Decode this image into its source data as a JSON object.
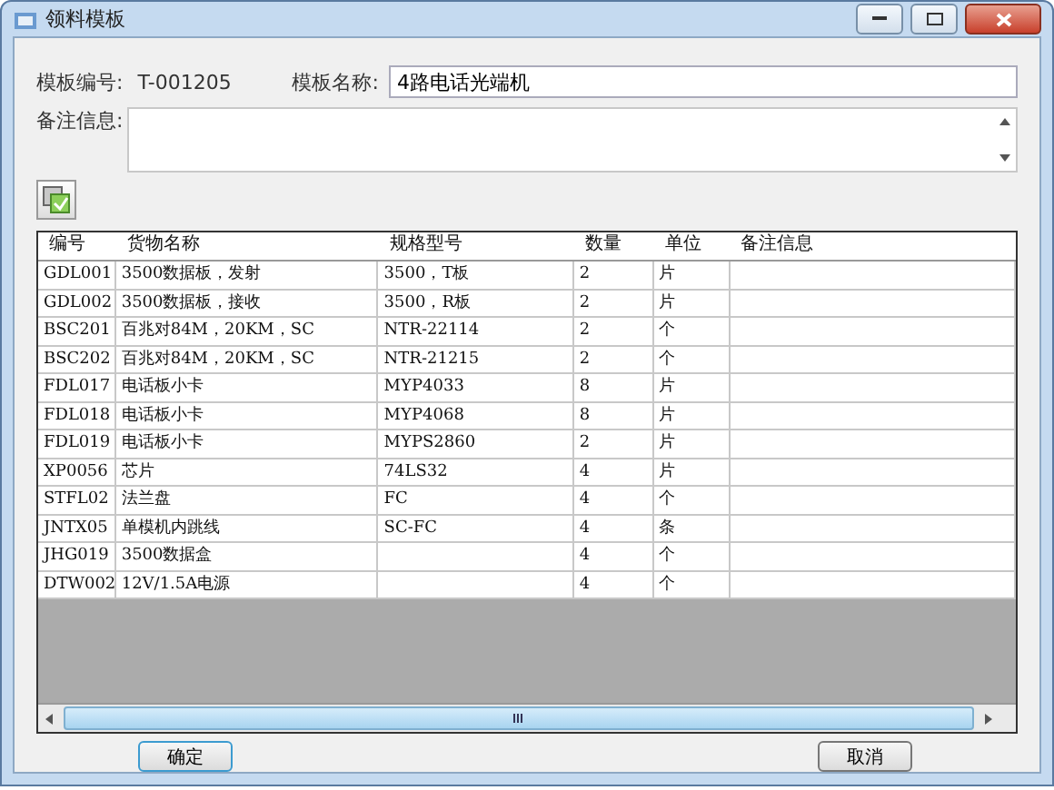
{
  "window": {
    "title": "领料模板"
  },
  "template_no": {
    "label": "模板编号:",
    "value": "T-001205"
  },
  "template_name": {
    "label": "模板名称:",
    "value": "4路电话光端机"
  },
  "remark": {
    "label": "备注信息:"
  },
  "table": {
    "columns": [
      "编号",
      "货物名称",
      "规格型号",
      "数量",
      "单位",
      "备注信息"
    ],
    "rows": [
      [
        "GDL001",
        "3500数据板，发射",
        "3500，T板",
        "2",
        "片"
      ],
      [
        "GDL002",
        "3500数据板，接收",
        "3500，R板",
        "2",
        "片"
      ],
      [
        "BSC201",
        "百兆对84M，20KM，SC",
        "NTR-22114",
        "2",
        "个"
      ],
      [
        "BSC202",
        "百兆对84M，20KM，SC",
        "NTR-21215",
        "2",
        "个"
      ],
      [
        "FDL017",
        "电话板小卡",
        "MYP4033",
        "8",
        "片"
      ],
      [
        "FDL018",
        "电话板小卡",
        "MYP4068",
        "8",
        "片"
      ],
      [
        "FDL019",
        "电话板小卡",
        "MYPS2860",
        "2",
        "片"
      ],
      [
        "XP0056",
        "芯片",
        "74LS32",
        "4",
        "片"
      ],
      [
        "STFL02",
        "法兰盘",
        "FC",
        "4",
        "个"
      ],
      [
        "JNTX05",
        "单模机内跳线",
        "SC-FC",
        "4",
        "条"
      ],
      [
        "JHG019",
        "3500数据盒",
        "",
        "4",
        "个"
      ],
      [
        "DTW002",
        "12V/1.5A电源",
        "",
        "4",
        "个"
      ]
    ]
  },
  "buttons": [
    "确定",
    "取消"
  ]
}
